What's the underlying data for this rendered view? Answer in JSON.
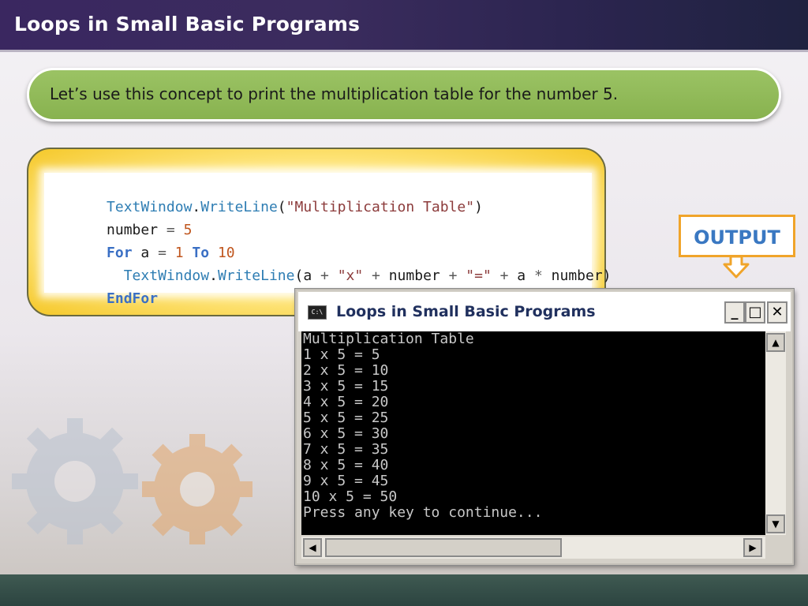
{
  "slide": {
    "title": "Loops in Small Basic Programs",
    "intro": "Let’s use this concept to print the multiplication table for the number 5."
  },
  "code": {
    "line1": {
      "obj": "TextWindow",
      "dot": ".",
      "method": "WriteLine",
      "open": "(",
      "str": "\"Multiplication Table\"",
      "close": ")"
    },
    "line2": {
      "var": "number",
      "op": " = ",
      "num": "5"
    },
    "line3": {
      "kw_for": "For",
      "var": " a ",
      "op": "= ",
      "num1": "1",
      "kw_to": " To ",
      "num2": "10"
    },
    "line4": {
      "indent": "  ",
      "obj": "TextWindow",
      "dot": ".",
      "method": "WriteLine",
      "open": "(",
      "a1": "a",
      "plus1": " + ",
      "str1": "\"x\"",
      "plus2": " + ",
      "var1": "number",
      "plus3": " + ",
      "str2": "\"=\"",
      "plus4": " + ",
      "a2": "a",
      "mul": " * ",
      "var2": "number",
      "close": ")"
    },
    "line5": {
      "kw_endfor": "EndFor"
    }
  },
  "output_label": "OUTPUT",
  "window": {
    "title": "Loops in Small Basic Programs",
    "icon_text": "C:\\",
    "buttons": {
      "minimize": "_",
      "maximize": "□",
      "close": "✕"
    },
    "console_lines": [
      "Multiplication Table",
      "1 x 5 = 5",
      "2 x 5 = 10",
      "3 x 5 = 15",
      "4 x 5 = 20",
      "5 x 5 = 25",
      "6 x 5 = 30",
      "7 x 5 = 35",
      "8 x 5 = 40",
      "9 x 5 = 45",
      "10 x 5 = 50",
      "Press any key to continue..."
    ],
    "scroll": {
      "up": "▲",
      "down": "▼",
      "left": "◀",
      "right": "▶"
    }
  },
  "colors": {
    "header": "#3a2760",
    "pill_green": "#8fb857",
    "code_panel_yellow": "#ffe884",
    "output_border": "#f0a42a",
    "output_text": "#3a78c2"
  }
}
